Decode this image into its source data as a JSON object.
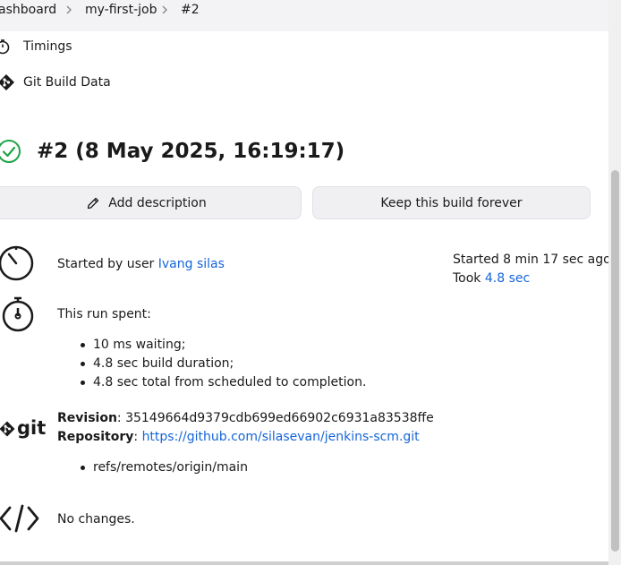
{
  "breadcrumb": {
    "dashboard": "ashboard",
    "job": "my-first-job",
    "build": "#2"
  },
  "sidebar": {
    "timings": "Timings",
    "git_build_data": "Git Build Data"
  },
  "build": {
    "title": "#2 (8 May 2025, 16:19:17)",
    "status_icon": "success-check-icon"
  },
  "buttons": {
    "add_description": "Add description",
    "keep_forever": "Keep this build forever"
  },
  "cause": {
    "prefix": "Started by user ",
    "user": "Ivang silas",
    "started": "Started 8 min 17 sec ago",
    "took_prefix": "Took ",
    "took_value": "4.8 sec"
  },
  "timing": {
    "heading": "This run spent:",
    "items": [
      "10 ms waiting;",
      "4.8 sec build duration;",
      "4.8 sec total from scheduled to completion."
    ]
  },
  "git": {
    "logo_text": "git",
    "revision_label": "Revision",
    "revision_value": ": 35149664d9379cdb699ed66902c6931a83538ffe",
    "repository_label": "Repository",
    "repository_sep": ": ",
    "repository_url": "https://github.com/silasevan/jenkins-scm.git",
    "branches": [
      "refs/remotes/origin/main"
    ]
  },
  "changes": {
    "text": "No changes."
  },
  "colors": {
    "link": "#1565d8",
    "success": "#1ea446",
    "button_bg": "#f0f0f3"
  }
}
